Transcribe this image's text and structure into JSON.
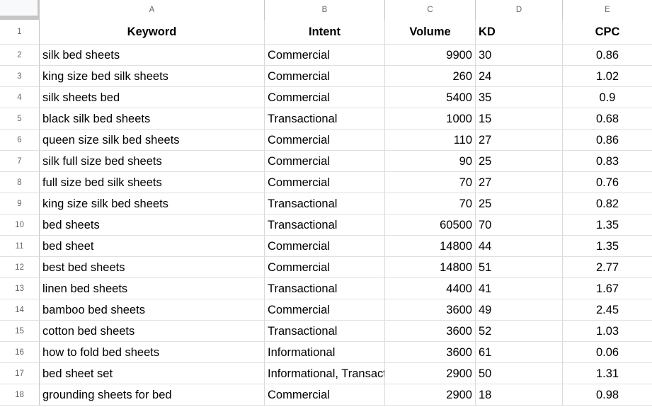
{
  "spreadsheet": {
    "column_letters": [
      "A",
      "B",
      "C",
      "D",
      "E"
    ],
    "row_numbers": [
      "1",
      "2",
      "3",
      "4",
      "5",
      "6",
      "7",
      "8",
      "9",
      "10",
      "11",
      "12",
      "13",
      "14",
      "15",
      "16",
      "17",
      "18"
    ],
    "headers": {
      "a": "Keyword",
      "b": "Intent",
      "c": "Volume",
      "d": "KD",
      "e": "CPC"
    },
    "rows": [
      {
        "keyword": "silk bed sheets",
        "intent": "Commercial",
        "volume": "9900",
        "kd": "30",
        "cpc": "0.86"
      },
      {
        "keyword": "king size bed silk sheets",
        "intent": "Commercial",
        "volume": "260",
        "kd": "24",
        "cpc": "1.02"
      },
      {
        "keyword": "silk sheets bed",
        "intent": "Commercial",
        "volume": "5400",
        "kd": "35",
        "cpc": "0.9"
      },
      {
        "keyword": "black silk bed sheets",
        "intent": "Transactional",
        "volume": "1000",
        "kd": "15",
        "cpc": "0.68"
      },
      {
        "keyword": "queen size silk bed sheets",
        "intent": "Commercial",
        "volume": "110",
        "kd": "27",
        "cpc": "0.86"
      },
      {
        "keyword": "silk full size bed sheets",
        "intent": "Commercial",
        "volume": "90",
        "kd": "25",
        "cpc": "0.83"
      },
      {
        "keyword": "full size bed silk sheets",
        "intent": "Commercial",
        "volume": "70",
        "kd": "27",
        "cpc": "0.76"
      },
      {
        "keyword": "king size silk bed sheets",
        "intent": "Transactional",
        "volume": "70",
        "kd": "25",
        "cpc": "0.82"
      },
      {
        "keyword": "bed sheets",
        "intent": "Transactional",
        "volume": "60500",
        "kd": "70",
        "cpc": "1.35"
      },
      {
        "keyword": "bed sheet",
        "intent": "Commercial",
        "volume": "14800",
        "kd": "44",
        "cpc": "1.35"
      },
      {
        "keyword": "best bed sheets",
        "intent": "Commercial",
        "volume": "14800",
        "kd": "51",
        "cpc": "2.77"
      },
      {
        "keyword": "linen bed sheets",
        "intent": "Transactional",
        "volume": "4400",
        "kd": "41",
        "cpc": "1.67"
      },
      {
        "keyword": "bamboo bed sheets",
        "intent": "Commercial",
        "volume": "3600",
        "kd": "49",
        "cpc": "2.45"
      },
      {
        "keyword": "cotton bed sheets",
        "intent": "Transactional",
        "volume": "3600",
        "kd": "52",
        "cpc": "1.03"
      },
      {
        "keyword": "how to fold bed sheets",
        "intent": "Informational",
        "volume": "3600",
        "kd": "61",
        "cpc": "0.06"
      },
      {
        "keyword": "bed sheet set",
        "intent": "Informational, Transactional",
        "volume": "2900",
        "kd": "50",
        "cpc": "1.31"
      },
      {
        "keyword": "grounding sheets for bed",
        "intent": "Commercial",
        "volume": "2900",
        "kd": "18",
        "cpc": "0.98"
      }
    ]
  }
}
